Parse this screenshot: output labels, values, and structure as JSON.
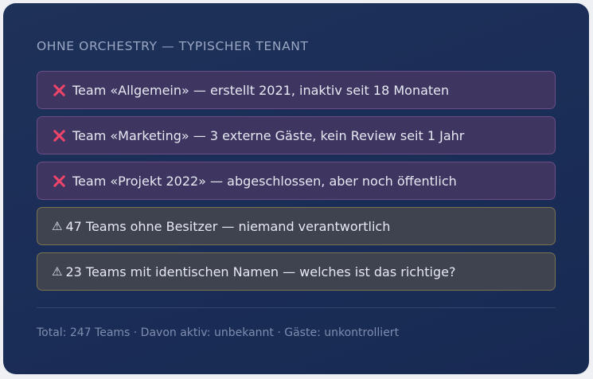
{
  "panel": {
    "heading": "OHNE ORCHESTRY — TYPISCHER TENANT",
    "items": [
      {
        "type": "error",
        "icon": "x-icon",
        "text": "Team «Allgemein» — erstellt 2021, inaktiv seit 18 Monaten"
      },
      {
        "type": "error",
        "icon": "x-icon",
        "text": "Team «Marketing» — 3 externe Gäste, kein Review seit 1 Jahr"
      },
      {
        "type": "error",
        "icon": "x-icon",
        "text": "Team «Projekt 2022» — abgeschlossen, aber noch öffentlich"
      },
      {
        "type": "warning",
        "icon": "warning-icon",
        "text": "47 Teams ohne Besitzer — niemand verantwortlich"
      },
      {
        "type": "warning",
        "icon": "warning-icon",
        "text": "23 Teams mit identischen Namen — welches ist das richtige?"
      }
    ],
    "footer": "Total: 247 Teams · Davon aktiv: unbekannt · Gäste: unkontrolliert"
  },
  "colors": {
    "error_accent": "#f0456b",
    "error_bg": "#3e3560",
    "warning_bg": "#3f4350",
    "panel_bg": "#1e3158"
  }
}
